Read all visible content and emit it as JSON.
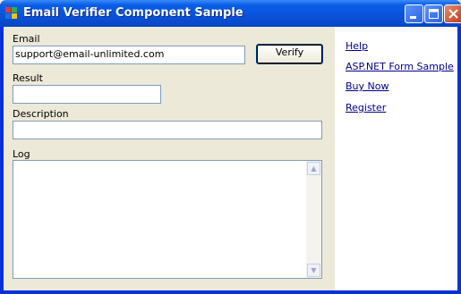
{
  "window": {
    "title": "Email Verifier Component Sample"
  },
  "form": {
    "email_label": "Email",
    "email_value": "support@email-unlimited.com",
    "verify_button": "Verify",
    "result_label": "Result",
    "result_value": "",
    "description_label": "Description",
    "description_value": "",
    "log_label": "Log",
    "log_value": ""
  },
  "links": [
    "Help",
    "ASP.NET Form Sample",
    "Buy Now",
    "Register"
  ],
  "icons": {
    "app": "app-icon",
    "minimize": "minimize-icon",
    "maximize": "maximize-icon",
    "close": "close-icon",
    "scroll_up": "scroll-up-arrow-icon",
    "scroll_down": "scroll-down-arrow-icon"
  },
  "colors": {
    "titlebar": "#0a5ee8",
    "dialog": "#ece9d8",
    "link": "#00008b",
    "field_border": "#7f9db9"
  }
}
